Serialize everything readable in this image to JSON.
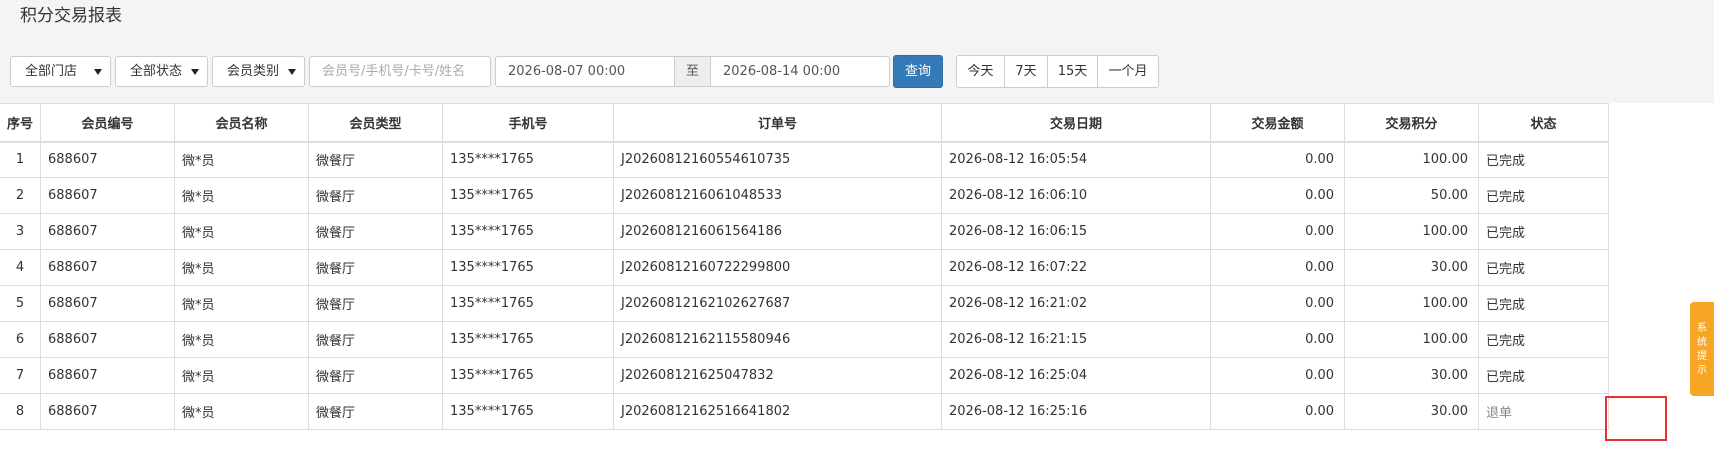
{
  "page": {
    "title": "积分交易报表"
  },
  "filters": {
    "store": "全部门店",
    "status": "全部状态",
    "member_type": "会员类别",
    "search_placeholder": "会员号/手机号/卡号/姓名",
    "date_from": "2026-08-07 00:00",
    "range_separator": "至",
    "date_to": "2026-08-14 00:00",
    "query_label": "查询",
    "quick_ranges": [
      "今天",
      "7天",
      "15天",
      "一个月"
    ]
  },
  "table": {
    "columns": [
      "序号",
      "会员编号",
      "会员名称",
      "会员类型",
      "手机号",
      "订单号",
      "交易日期",
      "交易金额",
      "交易积分",
      "状态"
    ],
    "rows": [
      [
        "1",
        "688607",
        "微*员",
        "微餐厅",
        "135****1765",
        "J20260812160554610735",
        "2026-08-12 16:05:54",
        "0.00",
        "100.00",
        "已完成"
      ],
      [
        "2",
        "688607",
        "微*员",
        "微餐厅",
        "135****1765",
        "J2026081216061048533",
        "2026-08-12 16:06:10",
        "0.00",
        "50.00",
        "已完成"
      ],
      [
        "3",
        "688607",
        "微*员",
        "微餐厅",
        "135****1765",
        "J2026081216061564186",
        "2026-08-12 16:06:15",
        "0.00",
        "100.00",
        "已完成"
      ],
      [
        "4",
        "688607",
        "微*员",
        "微餐厅",
        "135****1765",
        "J20260812160722299800",
        "2026-08-12 16:07:22",
        "0.00",
        "30.00",
        "已完成"
      ],
      [
        "5",
        "688607",
        "微*员",
        "微餐厅",
        "135****1765",
        "J20260812162102627687",
        "2026-08-12 16:21:02",
        "0.00",
        "100.00",
        "已完成"
      ],
      [
        "6",
        "688607",
        "微*员",
        "微餐厅",
        "135****1765",
        "J20260812162115580946",
        "2026-08-12 16:21:15",
        "0.00",
        "100.00",
        "已完成"
      ],
      [
        "7",
        "688607",
        "微*员",
        "微餐厅",
        "135****1765",
        "J202608121625047832",
        "2026-08-12 16:25:04",
        "0.00",
        "30.00",
        "已完成"
      ],
      [
        "8",
        "688607",
        "微*员",
        "微餐厅",
        "135****1765",
        "J20260812162516641802",
        "2026-08-12 16:25:16",
        "0.00",
        "30.00",
        "退单"
      ]
    ]
  },
  "side_tab": {
    "label": "系统提示"
  },
  "colors": {
    "primary": "#337ab7",
    "side_tab": "#f6a623",
    "highlight": "#e53333"
  }
}
